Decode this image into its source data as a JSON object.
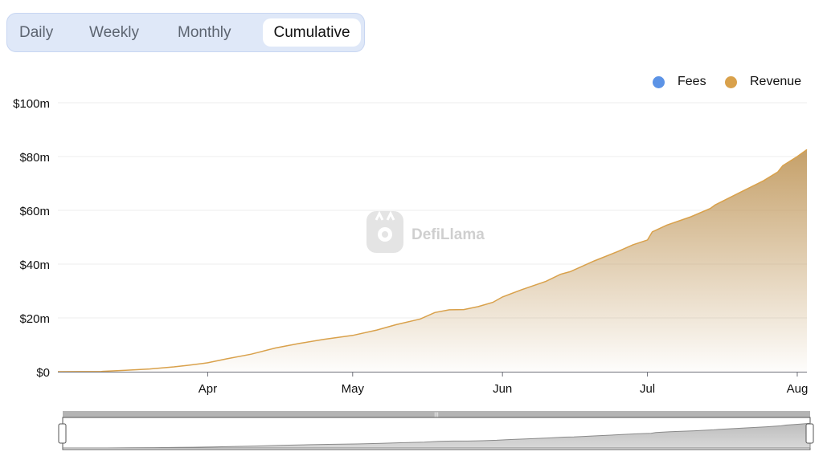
{
  "tabs": {
    "daily": "Daily",
    "weekly": "Weekly",
    "monthly": "Monthly",
    "cumulative": "Cumulative",
    "active": "Cumulative"
  },
  "legend": {
    "fees": {
      "label": "Fees",
      "color": "#5c93e6"
    },
    "revenue": {
      "label": "Revenue",
      "color": "#d9a14b"
    }
  },
  "watermark": "DefiLlama",
  "chart_data": {
    "type": "area",
    "title": "",
    "xlabel": "",
    "ylabel": "",
    "ylim": [
      0,
      100
    ],
    "y_unit": "millions USD",
    "y_tick_labels": [
      "$0",
      "$20m",
      "$40m",
      "$60m",
      "$80m",
      "$100m"
    ],
    "y_ticks": [
      0,
      20,
      40,
      60,
      80,
      100
    ],
    "x_tick_labels": [
      "Apr",
      "May",
      "Jun",
      "Jul",
      "Aug"
    ],
    "x_ticks": [
      "2024-04-01",
      "2024-05-01",
      "2024-06-01",
      "2024-07-01",
      "2024-08-01"
    ],
    "xlim": [
      "2024-03-01",
      "2024-08-03"
    ],
    "grid": true,
    "legend_position": "top-right",
    "series": [
      {
        "name": "Revenue",
        "color": "#d9a14b",
        "x": [
          "2024-03-01",
          "2024-03-10",
          "2024-03-15",
          "2024-03-20",
          "2024-03-25",
          "2024-03-28",
          "2024-04-01",
          "2024-04-05",
          "2024-04-10",
          "2024-04-15",
          "2024-04-20",
          "2024-04-25",
          "2024-05-01",
          "2024-05-06",
          "2024-05-10",
          "2024-05-15",
          "2024-05-18",
          "2024-05-21",
          "2024-05-24",
          "2024-05-27",
          "2024-05-30",
          "2024-06-01",
          "2024-06-05",
          "2024-06-10",
          "2024-06-13",
          "2024-06-15",
          "2024-06-20",
          "2024-06-25",
          "2024-06-28",
          "2024-07-01",
          "2024-07-02",
          "2024-07-05",
          "2024-07-10",
          "2024-07-14",
          "2024-07-15",
          "2024-07-20",
          "2024-07-25",
          "2024-07-28",
          "2024-07-29",
          "2024-08-01",
          "2024-08-03"
        ],
        "y": [
          0,
          0.1,
          0.5,
          1,
          1.8,
          2.4,
          3.3,
          4.8,
          6.5,
          8.8,
          10.5,
          12,
          13.5,
          15.5,
          17.5,
          19.6,
          22,
          23,
          23.1,
          24.2,
          25.8,
          27.8,
          30.5,
          33.6,
          36.2,
          37.2,
          41.2,
          44.8,
          47.2,
          49,
          52,
          54.5,
          57.6,
          60.7,
          62,
          66.5,
          71,
          74.3,
          76.6,
          80,
          82.6
        ]
      },
      {
        "name": "Fees",
        "color": "#5c93e6",
        "x": [],
        "y": []
      }
    ]
  }
}
